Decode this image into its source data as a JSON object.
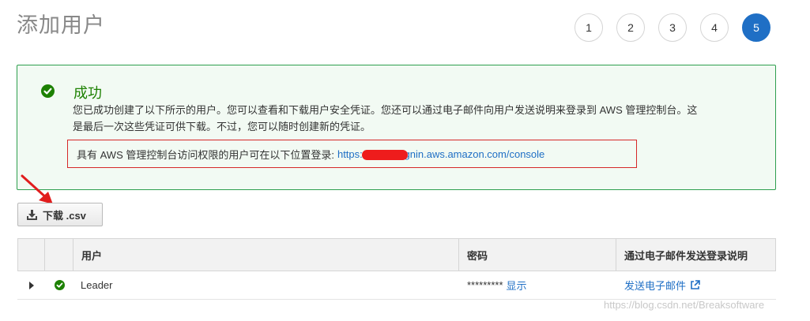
{
  "header": {
    "title": "添加用户"
  },
  "steps": [
    "1",
    "2",
    "3",
    "4",
    "5"
  ],
  "active_step": "5",
  "alert": {
    "title": "成功",
    "line1": "您已成功创建了以下所示的用户。您可以查看和下载用户安全凭证。您还可以通过电子邮件向用户发送说明来登录到 AWS 管理控制台。这",
    "line2": "是最后一次这些凭证可供下载。不过，您可以随时创建新的凭证。",
    "login_prefix": "具有 AWS 管理控制台访问权限的用户可在以下位置登录:",
    "login_url": "https://17            84.signin.aws.amazon.com/console"
  },
  "download_button": {
    "label": "下载 .csv"
  },
  "table": {
    "headers": [
      "",
      "",
      "用户",
      "密码",
      "通过电子邮件发送登录说明"
    ],
    "rows": [
      {
        "user": "Leader",
        "password_mask": "*********",
        "show_label": "显示",
        "email_label": "发送电子邮件"
      }
    ]
  },
  "watermark": "https://blog.csdn.net/Breaksoftware",
  "colors": {
    "accent": "#1f6fc5",
    "success": "#1d8102",
    "alert_bg": "#f2faf3",
    "alert_border": "#2e9f4e",
    "highlight_border": "#d62828"
  }
}
